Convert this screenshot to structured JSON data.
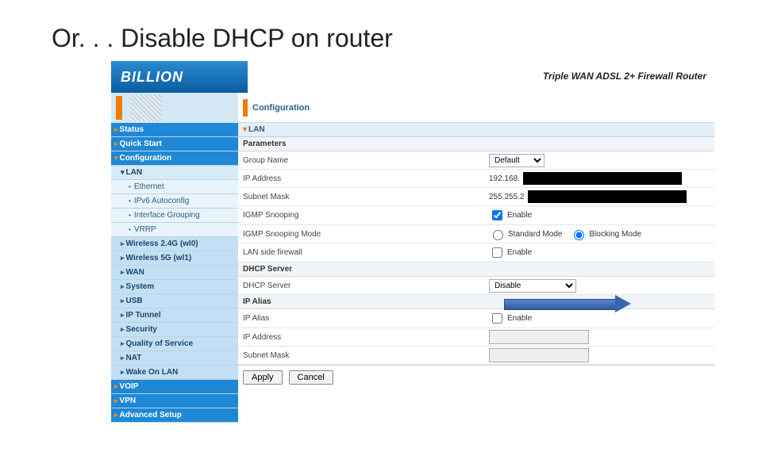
{
  "slide": {
    "title": "Or. . . Disable DHCP on router"
  },
  "header": {
    "brand": "BILLION",
    "device": "Triple WAN ADSL 2+ Firewall Router",
    "ribbon_label": "Configuration"
  },
  "sidebar": {
    "items": [
      {
        "level": "lvl1",
        "label": "Status",
        "arrow": "▸"
      },
      {
        "level": "lvl1",
        "label": "Quick Start",
        "arrow": "▸"
      },
      {
        "level": "lvl1",
        "label": "Configuration",
        "arrow": "▾"
      },
      {
        "level": "lvl2a",
        "label": "LAN",
        "arrow": "▾"
      },
      {
        "level": "lvl3",
        "label": "Ethernet",
        "arrow": "•"
      },
      {
        "level": "lvl3",
        "label": "IPv6 Autoconfig",
        "arrow": "•"
      },
      {
        "level": "lvl3",
        "label": "Interface Grouping",
        "arrow": "•"
      },
      {
        "level": "lvl3",
        "label": "VRRP",
        "arrow": "•"
      },
      {
        "level": "lvl2",
        "label": "Wireless 2.4G (wl0)",
        "arrow": "▸"
      },
      {
        "level": "lvl2",
        "label": "Wireless 5G (wl1)",
        "arrow": "▸"
      },
      {
        "level": "lvl2",
        "label": "WAN",
        "arrow": "▸"
      },
      {
        "level": "lvl2",
        "label": "System",
        "arrow": "▸"
      },
      {
        "level": "lvl2",
        "label": "USB",
        "arrow": "▸"
      },
      {
        "level": "lvl2",
        "label": "IP Tunnel",
        "arrow": "▸"
      },
      {
        "level": "lvl2",
        "label": "Security",
        "arrow": "▸"
      },
      {
        "level": "lvl2",
        "label": "Quality of Service",
        "arrow": "▸"
      },
      {
        "level": "lvl2",
        "label": "NAT",
        "arrow": "▸"
      },
      {
        "level": "lvl2",
        "label": "Wake On LAN",
        "arrow": "▸"
      },
      {
        "level": "lvl1",
        "label": "VOIP",
        "arrow": "▸"
      },
      {
        "level": "lvl1",
        "label": "VPN",
        "arrow": "▸"
      },
      {
        "level": "lvl1",
        "label": "Advanced Setup",
        "arrow": "▸"
      }
    ]
  },
  "main": {
    "section_lan": "LAN",
    "section_params": "Parameters",
    "fields": {
      "group_name": {
        "label": "Group Name",
        "value": "Default"
      },
      "ip_address": {
        "label": "IP Address",
        "prefix": "192.168."
      },
      "subnet": {
        "label": "Subnet Mask",
        "prefix": "255.255.2"
      },
      "igmp_snoop": {
        "label": "IGMP Snooping",
        "enable_label": "Enable",
        "checked": true
      },
      "igmp_mode": {
        "label": "IGMP Snooping Mode",
        "opt1": "Standard Mode",
        "opt2": "Blocking Mode",
        "selected": "opt2"
      },
      "lan_fw": {
        "label": "LAN side firewall",
        "enable_label": "Enable",
        "checked": false
      }
    },
    "section_dhcp": "DHCP Server",
    "dhcp": {
      "label": "DHCP Server",
      "value": "Disable"
    },
    "section_ipalias": "IP Alias",
    "ipalias": {
      "enable_label": "IP Alias",
      "enable_text": "Enable",
      "ip_label": "IP Address",
      "subnet_label": "Subnet Mask"
    },
    "buttons": {
      "apply": "Apply",
      "cancel": "Cancel"
    }
  }
}
